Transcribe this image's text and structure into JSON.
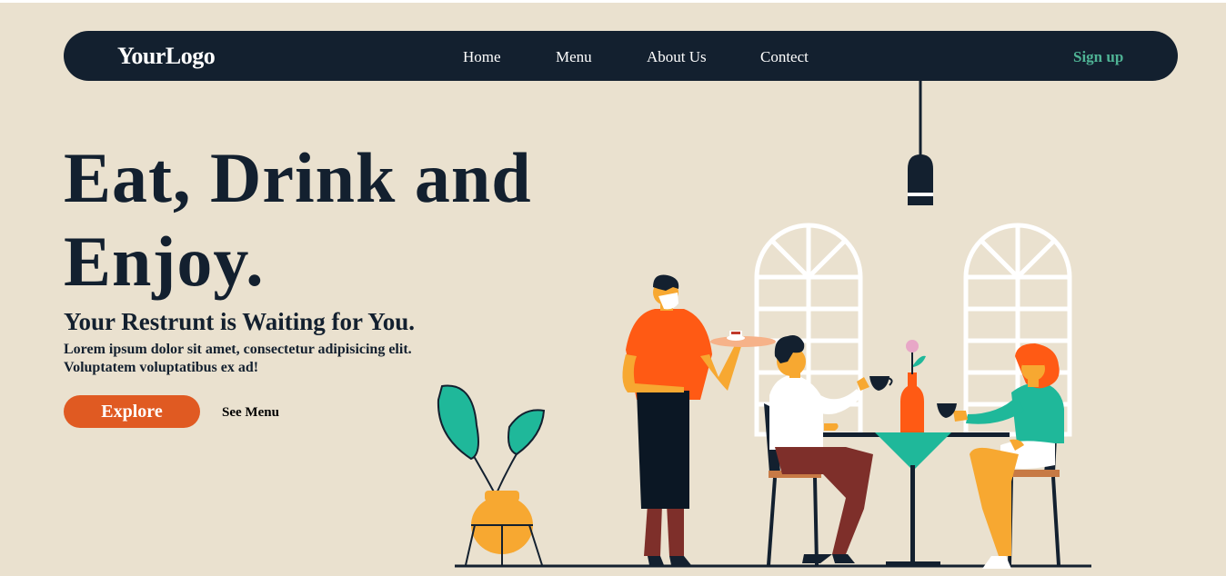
{
  "nav": {
    "logo": "YourLogo",
    "links": [
      "Home",
      "Menu",
      "About Us",
      "Contect"
    ],
    "signup": "Sign up"
  },
  "hero": {
    "title_line1": "Eat, Drink and",
    "title_line2": "Enjoy.",
    "subtitle": "Your Restrunt is Waiting for You.",
    "description": "Lorem ipsum dolor sit amet, consectetur adipisicing elit. Voluptatem voluptatibus ex ad!",
    "explore_label": "Explore",
    "see_menu_label": "See Menu"
  },
  "colors": {
    "background": "#eae1cf",
    "navbar": "#13202f",
    "accent": "#e05a22",
    "signup": "#4fb395"
  },
  "illustration": {
    "icons": [
      "pendant-lamp-icon",
      "arched-window-icon",
      "potted-plant-icon",
      "waiter-icon",
      "diner-man-icon",
      "diner-woman-icon",
      "table-icon",
      "wine-bottle-icon"
    ]
  }
}
